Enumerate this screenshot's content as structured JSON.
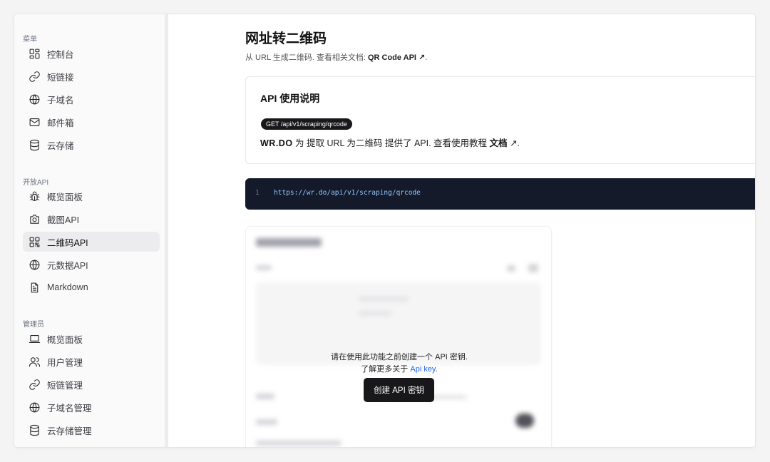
{
  "sidebar": {
    "section_menu": "菜单",
    "menu_items": [
      {
        "label": "控制台",
        "icon": "dashboard-icon"
      },
      {
        "label": "短链接",
        "icon": "link-icon"
      },
      {
        "label": "子域名",
        "icon": "globe-icon"
      },
      {
        "label": "邮件箱",
        "icon": "mail-icon"
      },
      {
        "label": "云存储",
        "icon": "database-icon"
      }
    ],
    "section_api": "开放API",
    "api_items": [
      {
        "label": "概览面板",
        "icon": "bug-icon"
      },
      {
        "label": "截图API",
        "icon": "camera-icon"
      },
      {
        "label": "二维码API",
        "icon": "qrcode-icon",
        "active": true
      },
      {
        "label": "元数据API",
        "icon": "globe-icon"
      },
      {
        "label": "Markdown",
        "icon": "file-text-icon"
      }
    ],
    "section_admin": "管理员",
    "admin_items": [
      {
        "label": "概览面板",
        "icon": "laptop-icon"
      },
      {
        "label": "用户管理",
        "icon": "users-icon"
      },
      {
        "label": "短链管理",
        "icon": "link-icon"
      },
      {
        "label": "子域名管理",
        "icon": "globe-icon"
      },
      {
        "label": "云存储管理",
        "icon": "database-icon"
      }
    ]
  },
  "header": {
    "title": "网址转二维码",
    "subtitle_prefix": "从 URL 生成二维码. 查看相关文档: ",
    "subtitle_link": "QR Code API ↗",
    "subtitle_suffix": "."
  },
  "api_card": {
    "title": "API 使用说明",
    "endpoint": "GET /api/v1/scraping/qrcode",
    "brand": "WR.DO",
    "desc_middle": " 为 提取 URL 为二维码 提供了 API. 查看使用教程 ",
    "docs_link": "文档",
    "docs_suffix": " ↗."
  },
  "code": {
    "line_number": "1",
    "url": "https://wr.do/api/v1/scraping/qrcode"
  },
  "overlay": {
    "message_line1": "请在使用此功能之前创建一个 API 密钥.",
    "message_line2_prefix": "了解更多关于 ",
    "message_line2_link": "Api key",
    "message_line2_suffix": ".",
    "button_label": "创建 API 密钥"
  },
  "colors": {
    "accent_dark": "#18181b",
    "link_blue": "#2563eb",
    "code_bg": "#141a2a",
    "code_text": "#93c5fd"
  }
}
